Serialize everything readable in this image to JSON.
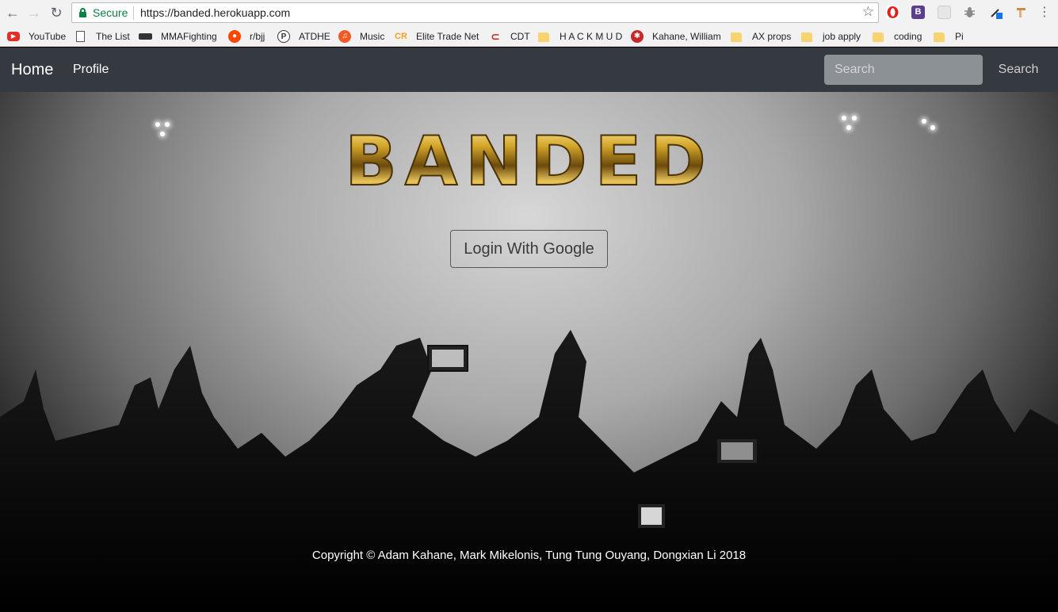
{
  "browser": {
    "secure_label": "Secure",
    "url": "https://banded.herokuapp.com",
    "bookmarks": [
      {
        "label": "YouTube"
      },
      {
        "label": "The List"
      },
      {
        "label": "MMAFighting"
      },
      {
        "label": "r/bjj"
      },
      {
        "label": "ATDHE"
      },
      {
        "label": "Music"
      },
      {
        "label": "Elite Trade Net"
      },
      {
        "label": "CDT"
      },
      {
        "label": "H A C K M U D"
      },
      {
        "label": "Kahane, William"
      },
      {
        "label": "AX props"
      },
      {
        "label": "job apply"
      },
      {
        "label": "coding"
      },
      {
        "label": "Pi"
      }
    ],
    "bookmark_icon_texts": {
      "elite": "CR"
    }
  },
  "navbar": {
    "brand": "Home",
    "profile_link": "Profile",
    "search_placeholder": "Search",
    "search_button": "Search"
  },
  "hero": {
    "logo_text": "BANDED",
    "login_button": "Login With Google"
  },
  "footer": {
    "copyright": "Copyright © Adam Kahane, Mark Mikelonis, Tung Tung Ouyang, Dongxian Li 2018"
  },
  "colors": {
    "navbar_bg": "#343a40",
    "secure_green": "#0b8043",
    "logo_gold": "#d4a62a"
  }
}
